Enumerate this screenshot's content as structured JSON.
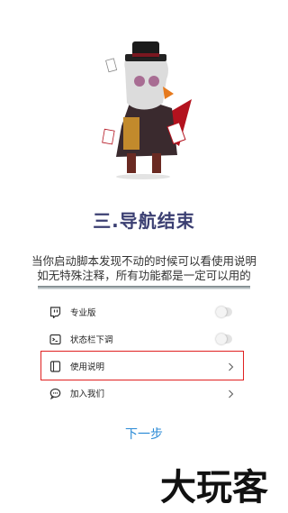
{
  "title": "三.导航结束",
  "description": {
    "line1": "当你启动脚本发现不动的时候可以看使用说明",
    "line2": "如无特殊注释，所有功能都是一定可以用的"
  },
  "settings": {
    "items": [
      {
        "label": "专业版",
        "icon": "twitch-icon",
        "control": "toggle",
        "on": false
      },
      {
        "label": "状态栏下调",
        "icon": "terminal-icon",
        "control": "toggle",
        "on": false
      },
      {
        "label": "使用说明",
        "icon": "document-icon",
        "control": "chevron",
        "highlighted": true
      },
      {
        "label": "加入我们",
        "icon": "chat-bubble-icon",
        "control": "chevron"
      }
    ]
  },
  "next_button": "下一步",
  "watermark": "大玩客",
  "colors": {
    "title": "#3b3f72",
    "link": "#2a8ad6",
    "highlight": "#e02020"
  }
}
